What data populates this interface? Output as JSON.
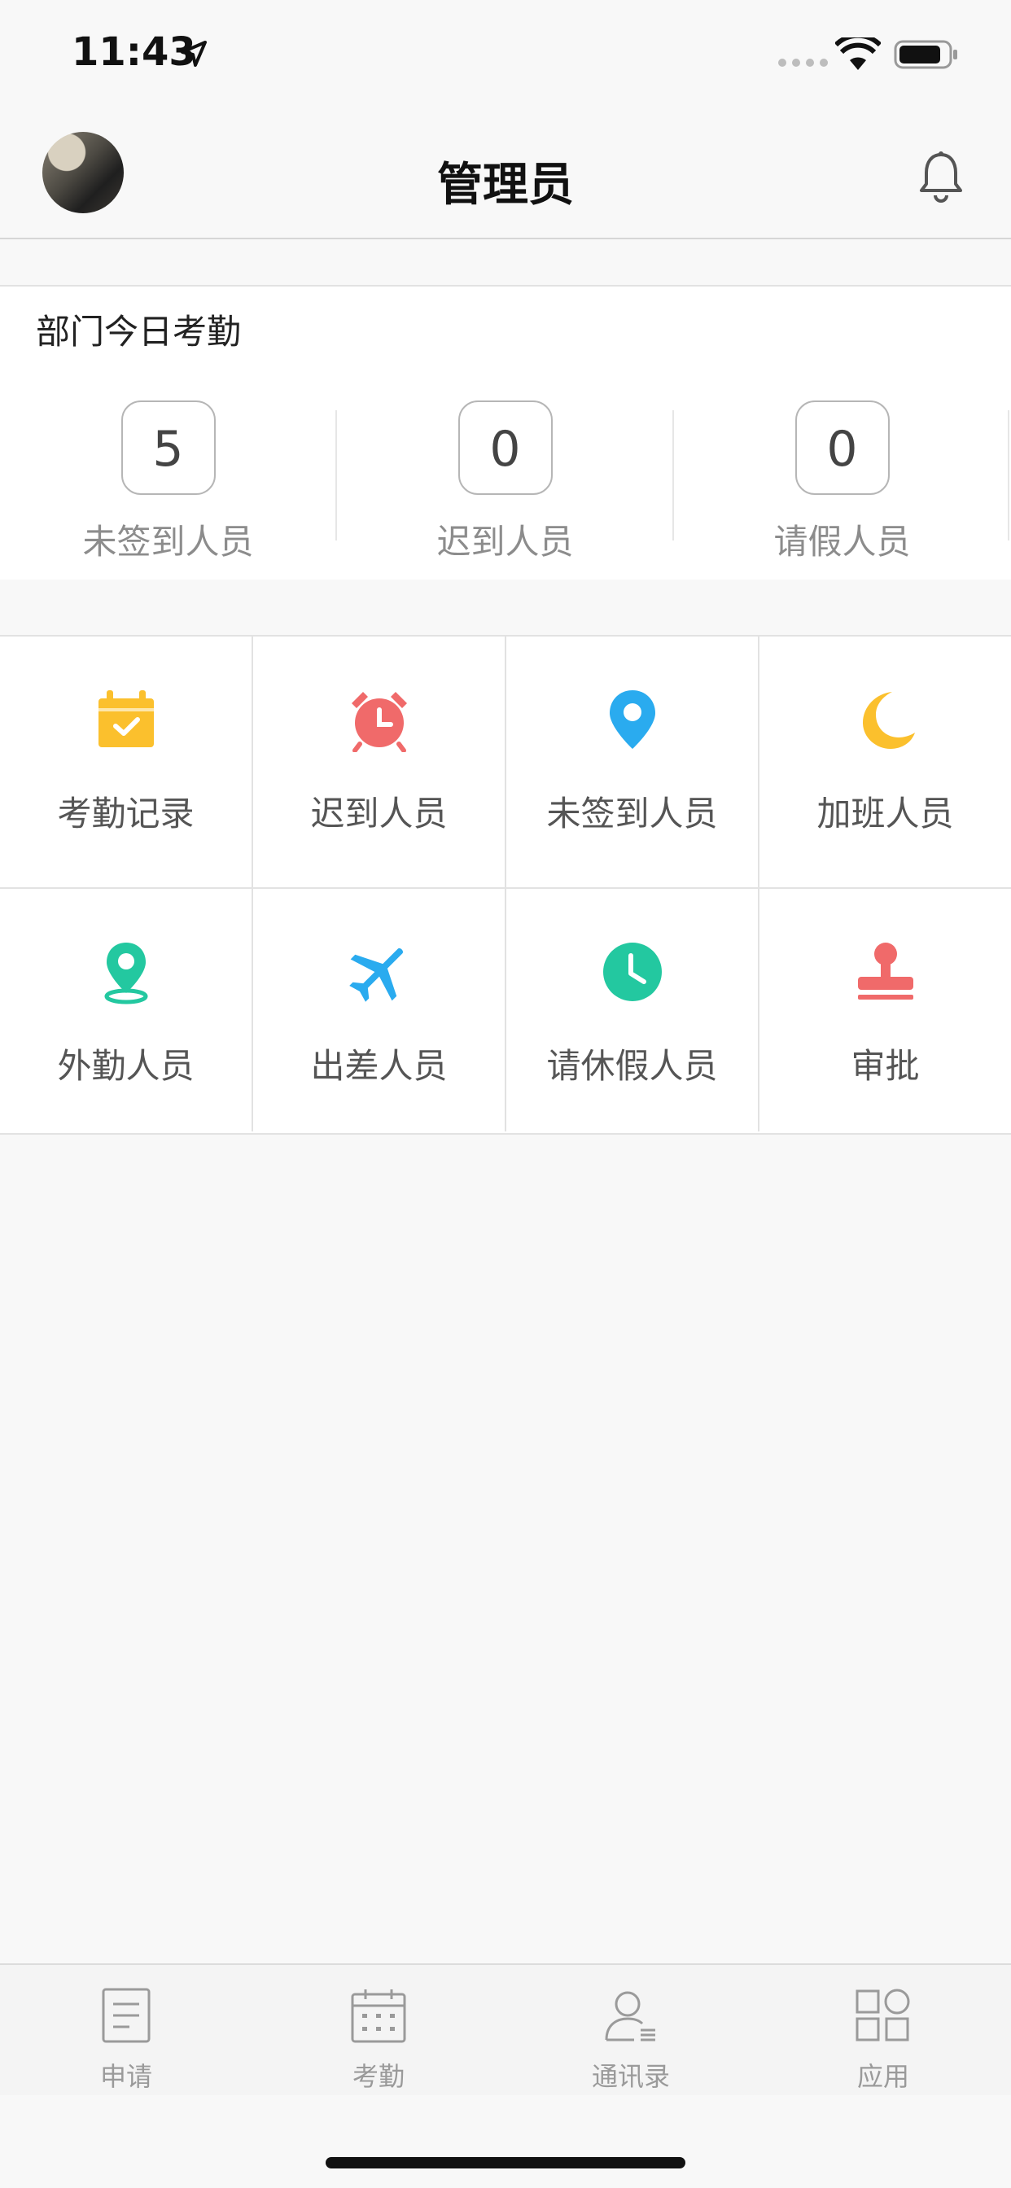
{
  "status_bar": {
    "time": "11:43"
  },
  "header": {
    "title": "管理员"
  },
  "attendance_today": {
    "title": "部门今日考勤",
    "stats": [
      {
        "value": "5",
        "label": "未签到人员"
      },
      {
        "value": "0",
        "label": "迟到人员"
      },
      {
        "value": "0",
        "label": "请假人员"
      }
    ]
  },
  "grid": {
    "items": [
      {
        "label": "考勤记录",
        "icon": "calendar-check-icon",
        "color": "#FBC02D"
      },
      {
        "label": "迟到人员",
        "icon": "alarm-clock-icon",
        "color": "#F06A6A"
      },
      {
        "label": "未签到人员",
        "icon": "location-pin-icon",
        "color": "#2AABEF"
      },
      {
        "label": "加班人员",
        "icon": "moon-icon",
        "color": "#FBC02D"
      },
      {
        "label": "外勤人员",
        "icon": "map-pin-icon",
        "color": "#23C8A0"
      },
      {
        "label": "出差人员",
        "icon": "airplane-icon",
        "color": "#2AABEF"
      },
      {
        "label": "请休假人员",
        "icon": "clock-icon",
        "color": "#23C8A0"
      },
      {
        "label": "审批",
        "icon": "stamp-icon",
        "color": "#F06A6A"
      }
    ]
  },
  "tabbar": {
    "items": [
      {
        "label": "申请",
        "icon": "document-icon"
      },
      {
        "label": "考勤",
        "icon": "calendar-icon"
      },
      {
        "label": "通讯录",
        "icon": "contacts-icon"
      },
      {
        "label": "应用",
        "icon": "apps-icon"
      }
    ]
  }
}
